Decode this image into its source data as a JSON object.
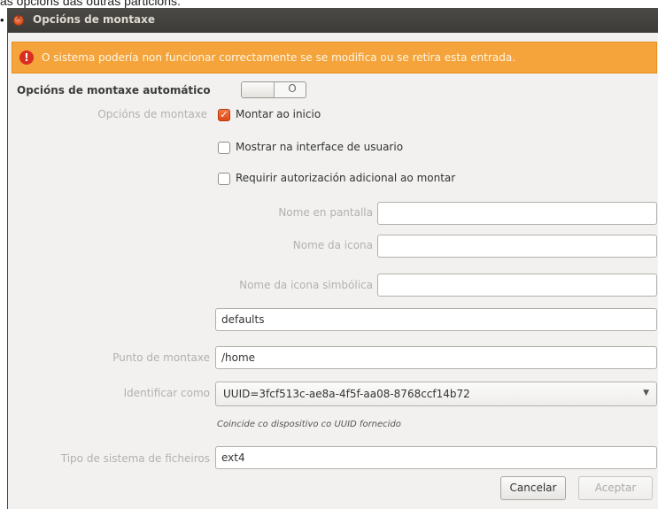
{
  "page": {
    "caption": "as opcións das outras particións."
  },
  "window": {
    "title": "Opcións de montaxe"
  },
  "warning": {
    "text": "O sistema podería non funcionar correctamente se se modifica ou se retira esta entrada."
  },
  "automount": {
    "label": "Opcións de montaxe automático",
    "switch_state": "O",
    "enabled": false
  },
  "mount_options": {
    "label": "Opcións de montaxe",
    "checkboxes": [
      {
        "label": "Montar ao inicio",
        "checked": true
      },
      {
        "label": "Mostrar na interface de usuario",
        "checked": false
      },
      {
        "label": "Requirir autorización adicional ao montar",
        "checked": false
      }
    ],
    "display_name": {
      "label": "Nome en pantalla",
      "value": ""
    },
    "icon_name": {
      "label": "Nome da icona",
      "value": ""
    },
    "symbolic_icon_name": {
      "label": "Nome da icona simbólica",
      "value": ""
    },
    "options_value": "defaults"
  },
  "mount_point": {
    "label": "Punto de montaxe",
    "value": "/home"
  },
  "identify_as": {
    "label": "Identificar como",
    "selected": "UUID=3fcf513c-ae8a-4f5f-aa08-8768ccf14b72",
    "hint": "Coincide co dispositivo co UUID fornecido"
  },
  "filesystem_type": {
    "label": "Tipo de sistema de ficheiros",
    "value": "ext4"
  },
  "buttons": {
    "cancel": "Cancelar",
    "accept": "Aceptar"
  },
  "colors": {
    "titlebar": "#3c3b37",
    "warning": "#f5a33b",
    "accent": "#dd4814",
    "background": "#f2f1f0"
  }
}
